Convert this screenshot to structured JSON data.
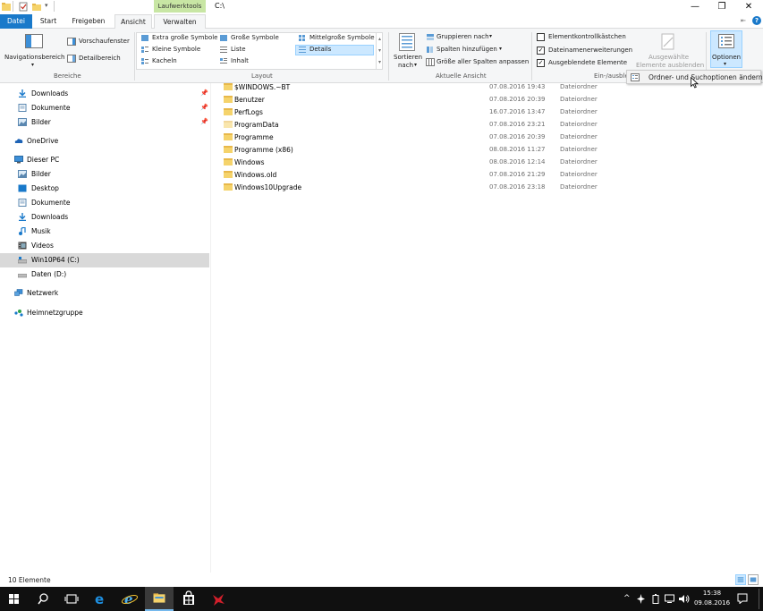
{
  "window": {
    "path": "C:\\",
    "context_tab_header": "Laufwerktools",
    "minimize": "—",
    "maximize": "❐",
    "close": "✕"
  },
  "tabs": [
    {
      "label": "Datei",
      "state": "file"
    },
    {
      "label": "Start",
      "state": "normal"
    },
    {
      "label": "Freigeben",
      "state": "normal"
    },
    {
      "label": "Ansicht",
      "state": "active"
    },
    {
      "label": "Verwalten",
      "state": "context"
    }
  ],
  "help": "?",
  "ribbon": {
    "bereiche": {
      "navigationsbereich": "Navigationsbereich",
      "vorschaufenster": "Vorschaufenster",
      "detailbereich": "Detailbereich",
      "label": "Bereiche"
    },
    "layout": {
      "items": [
        "Extra große Symbole",
        "Große Symbole",
        "Mittelgroße Symbole",
        "Kleine Symbole",
        "Liste",
        "Details",
        "Kacheln",
        "Inhalt"
      ],
      "selected": "Details",
      "label": "Layout"
    },
    "aktuelle_ansicht": {
      "sortieren": "Sortieren",
      "nach": "nach",
      "gruppieren": "Gruppieren nach",
      "spalten_hinzufuegen": "Spalten hinzufügen",
      "groesse_spalten": "Größe aller Spalten anpassen",
      "label": "Aktuelle Ansicht"
    },
    "ein_ausblenden": {
      "elementkontrollkaestchen": "Elementkontrollkästchen",
      "dateinamenerweiterungen": "Dateinamenerweiterungen",
      "ausgeblendete_elemente": "Ausgeblendete Elemente",
      "ausgewaehlte_1": "Ausgewählte",
      "ausgewaehlte_2": "Elemente ausblenden",
      "label": "Ein-/ausble"
    },
    "optionen": {
      "label": "Optionen"
    }
  },
  "dropdown": {
    "item": "Ordner- und Suchoptionen ändern"
  },
  "nav": {
    "items": [
      {
        "label": "Downloads",
        "icon": "download-icon",
        "pinned": true
      },
      {
        "label": "Dokumente",
        "icon": "documents-icon",
        "pinned": true
      },
      {
        "label": "Bilder",
        "icon": "pictures-icon",
        "pinned": true
      },
      {
        "label": "OneDrive",
        "icon": "onedrive-icon",
        "pinned": false
      },
      {
        "label": "Dieser PC",
        "icon": "this-pc-icon",
        "pinned": false
      },
      {
        "label": "Bilder",
        "icon": "pictures-icon",
        "pinned": false
      },
      {
        "label": "Desktop",
        "icon": "desktop-icon",
        "pinned": false
      },
      {
        "label": "Dokumente",
        "icon": "documents-icon",
        "pinned": false
      },
      {
        "label": "Downloads",
        "icon": "download-icon",
        "pinned": false
      },
      {
        "label": "Musik",
        "icon": "music-icon",
        "pinned": false
      },
      {
        "label": "Videos",
        "icon": "videos-icon",
        "pinned": false
      },
      {
        "label": "Win10P64 (C:)",
        "icon": "drive-icon",
        "pinned": false,
        "selected": true
      },
      {
        "label": "Daten (D:)",
        "icon": "drive-icon",
        "pinned": false
      },
      {
        "label": "Netzwerk",
        "icon": "network-icon",
        "pinned": false
      },
      {
        "label": "Heimnetzgruppe",
        "icon": "homegroup-icon",
        "pinned": false
      }
    ]
  },
  "files": [
    {
      "name": "$WINDOWS.~BT",
      "date": "07.08.2016 19:43",
      "type": "Dateiordner"
    },
    {
      "name": "Benutzer",
      "date": "07.08.2016 20:39",
      "type": "Dateiordner"
    },
    {
      "name": "PerfLogs",
      "date": "16.07.2016 13:47",
      "type": "Dateiordner"
    },
    {
      "name": "ProgramData",
      "date": "07.08.2016 23:21",
      "type": "Dateiordner"
    },
    {
      "name": "Programme",
      "date": "07.08.2016 20:39",
      "type": "Dateiordner"
    },
    {
      "name": "Programme (x86)",
      "date": "08.08.2016 11:27",
      "type": "Dateiordner"
    },
    {
      "name": "Windows",
      "date": "08.08.2016 12:14",
      "type": "Dateiordner"
    },
    {
      "name": "Windows.old",
      "date": "07.08.2016 21:29",
      "type": "Dateiordner"
    },
    {
      "name": "Windows10Upgrade",
      "date": "07.08.2016 23:18",
      "type": "Dateiordner"
    }
  ],
  "status": {
    "count": "10 Elemente"
  },
  "taskbar": {
    "time": "15:38",
    "date": "09.08.2016"
  },
  "colors": {
    "accent": "#1979ca",
    "selection": "#cce8ff",
    "folder": "#f5d36b",
    "context_tab": "#c8e6a4",
    "taskbar": "#101010"
  }
}
